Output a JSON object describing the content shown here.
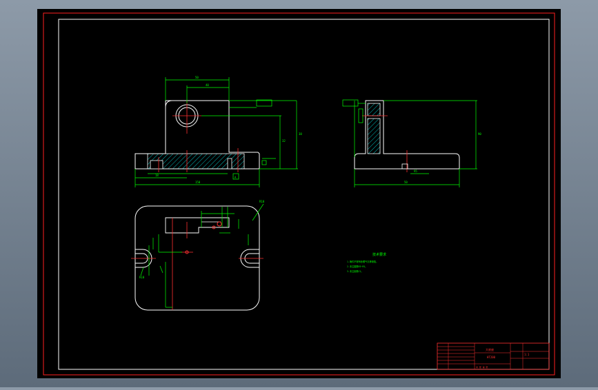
{
  "colors": {
    "background": "#000000",
    "outer_border": "#ff2020",
    "frame": "#ffffff",
    "outline": "#ffffff",
    "dimension": "#00ff00",
    "centerline": "#ff3030",
    "hatch": "#00c0c0",
    "title_block": "#ff3030",
    "ui_backdrop": "#7f8c99"
  },
  "title_block": {
    "part_name": "大底座",
    "material": "HT200",
    "scale": "1:1",
    "sheet": "共 张 第 张"
  },
  "notes": {
    "heading": "技术要求",
    "lines": [
      "1.铸件不得有砂眼气孔等缺陷。",
      "2.未注圆角R3~R5。",
      "3.未注倒角C1。"
    ]
  },
  "views": {
    "front": {
      "dims": [
        "50",
        "40",
        "38",
        "32",
        "18",
        "150"
      ],
      "datum": "A"
    },
    "side": {
      "dims": [
        "50",
        "90",
        "95"
      ]
    },
    "top": {
      "dims": [
        "R10",
        "R10"
      ]
    }
  }
}
